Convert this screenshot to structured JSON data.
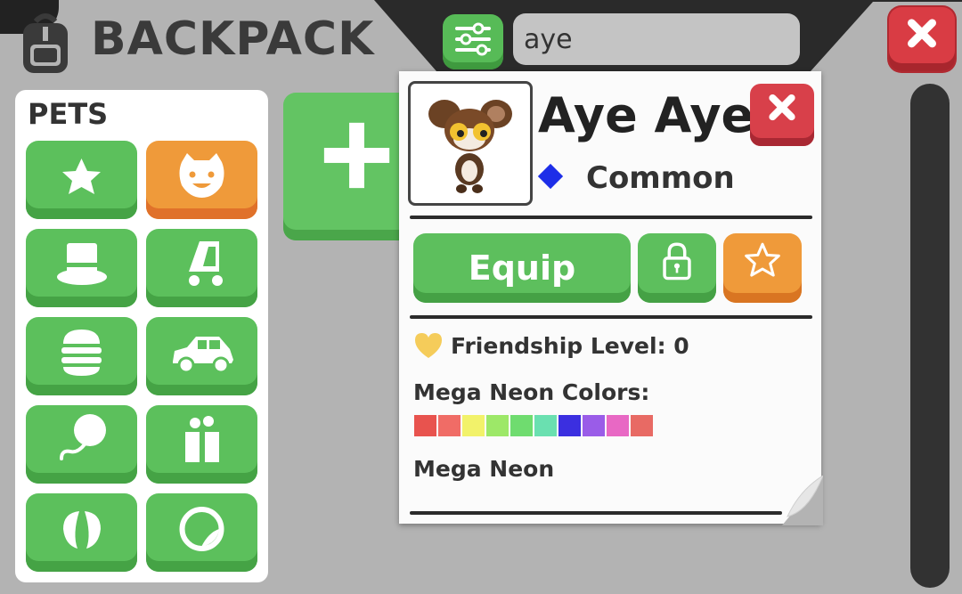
{
  "header": {
    "title": "BACKPACK",
    "search_value": "aye"
  },
  "categories": {
    "label": "PETS",
    "items": [
      {
        "icon": "star-icon",
        "selected": false
      },
      {
        "icon": "pet-face-icon",
        "selected": true
      },
      {
        "icon": "top-hat-icon",
        "selected": false
      },
      {
        "icon": "stroller-icon",
        "selected": false
      },
      {
        "icon": "burger-icon",
        "selected": false
      },
      {
        "icon": "car-icon",
        "selected": false
      },
      {
        "icon": "balloon-icon",
        "selected": false
      },
      {
        "icon": "gift-icon",
        "selected": false
      },
      {
        "icon": "wings-icon",
        "selected": false
      },
      {
        "icon": "sticker-icon",
        "selected": false
      }
    ]
  },
  "pet": {
    "name": "Aye Aye",
    "rarity": "Common",
    "rarity_color": "#1d2ee8",
    "equip_label": "Equip",
    "friendship_label": "Friendship Level: 0",
    "mega_neon_label": "Mega Neon Colors:",
    "mega_neon_status": "Mega Neon",
    "colors": [
      "#e8534e",
      "#f06c66",
      "#f2f26a",
      "#9de868",
      "#6fdc6f",
      "#6ae0b0",
      "#3b2fe0",
      "#9a5ce8",
      "#e868c4",
      "#e86a64"
    ]
  }
}
